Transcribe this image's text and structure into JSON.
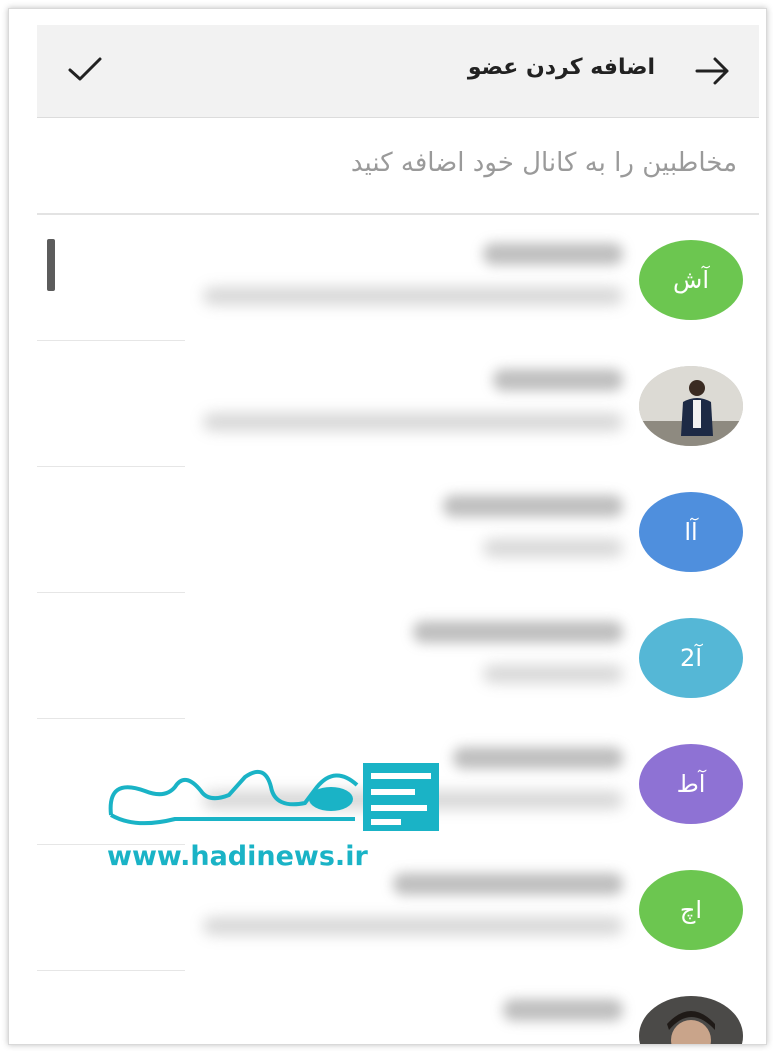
{
  "header": {
    "title": "اضافه کردن عضو",
    "icons": {
      "confirm": "check-icon",
      "back": "arrow-icon"
    }
  },
  "search": {
    "placeholder": "مخاطبین را به کانال خود اضافه کنید"
  },
  "contacts": [
    {
      "initials": "آش",
      "avatar_color": "#6cc650"
    },
    {
      "initials": "",
      "avatar_type": "photo"
    },
    {
      "initials": "آا",
      "avatar_color": "#4f8fdd"
    },
    {
      "initials": "آ2",
      "avatar_color": "#55b7d6"
    },
    {
      "initials": "آط",
      "avatar_color": "#8e72d4"
    },
    {
      "initials": "اچ",
      "avatar_color": "#6cc650"
    },
    {
      "initials": "",
      "avatar_type": "photo"
    }
  ],
  "watermark": {
    "url": "www.hadinews.ir",
    "color": "#1ab3c6"
  }
}
